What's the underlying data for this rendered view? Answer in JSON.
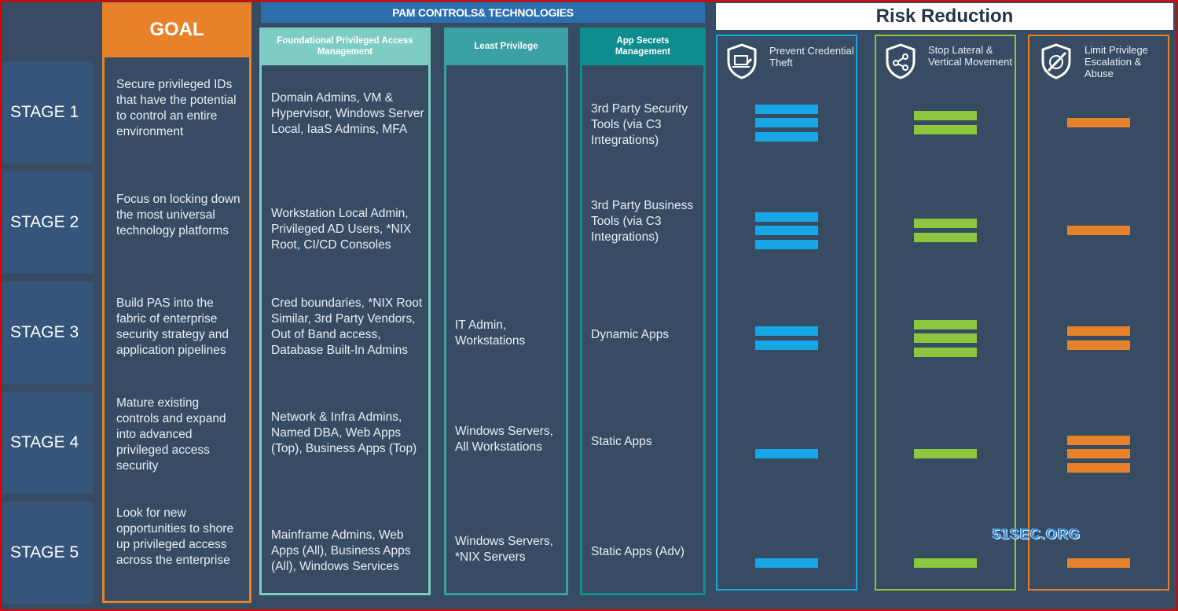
{
  "colors": {
    "frame": "#e00000",
    "background": "#374c63",
    "goal_orange": "#e8822a",
    "pam_banner_blue": "#2c6fae",
    "foundational_teal": "#7ecdc4",
    "least_privilege_teal": "#3aa0a3",
    "app_secrets_teal": "#0e8c8e",
    "prevent_blue": "#17a7e6",
    "lateral_green": "#8dc63f",
    "escalation_orange": "#e8822a"
  },
  "goal": {
    "header": "GOAL",
    "items": [
      "Secure privileged IDs that have the potential to control an entire environment",
      "Focus on locking down the most universal technology platforms",
      "Build PAS into the fabric of enterprise security strategy and application pipelines",
      "Mature existing controls and expand into advanced privileged access security",
      "Look for new opportunities to shore up privileged access across the enterprise"
    ]
  },
  "stages": [
    "STAGE 1",
    "STAGE 2",
    "STAGE 3",
    "STAGE 4",
    "STAGE 5"
  ],
  "pam": {
    "banner": "PAM CONTROLS& TECHNOLOGIES",
    "columns": [
      {
        "header": "Foundational Privileged Access Management",
        "items": [
          "Domain Admins, VM & Hypervisor, Windows Server Local, IaaS Admins, MFA",
          "Workstation Local Admin, Privileged AD Users, *NIX Root, CI/CD Consoles",
          "Cred boundaries, *NIX Root Similar, 3rd Party Vendors, Out of Band access, Database Built-In Admins",
          "Network & Infra Admins, Named DBA, Web Apps (Top), Business Apps (Top)",
          "Mainframe Admins, Web Apps (All), Business Apps (All), Windows Services"
        ]
      },
      {
        "header": "Least Privilege",
        "items": [
          "",
          "",
          "IT Admin, Workstations",
          "Windows Servers, All Workstations",
          "Windows Servers, *NIX Servers"
        ]
      },
      {
        "header": "App Secrets Management",
        "items": [
          "3rd Party Security Tools (via C3 Integrations)",
          "3rd Party Business Tools (via C3 Integrations)",
          "Dynamic Apps",
          "Static Apps",
          "Static Apps (Adv)"
        ]
      }
    ]
  },
  "risk": {
    "banner": "Risk Reduction",
    "columns": [
      {
        "label": "Prevent Credential Theft",
        "icon": "shield-laptop-icon",
        "bars": [
          3,
          3,
          2,
          1,
          1
        ]
      },
      {
        "label": "Stop Lateral & Vertical Movement",
        "icon": "shield-network-icon",
        "bars": [
          2,
          2,
          3,
          1,
          1
        ]
      },
      {
        "label": "Limit Privilege Escalation & Abuse",
        "icon": "shield-no-escalation-icon",
        "bars": [
          1,
          1,
          2,
          3,
          1
        ]
      }
    ]
  },
  "watermark": "51SEC.ORG"
}
